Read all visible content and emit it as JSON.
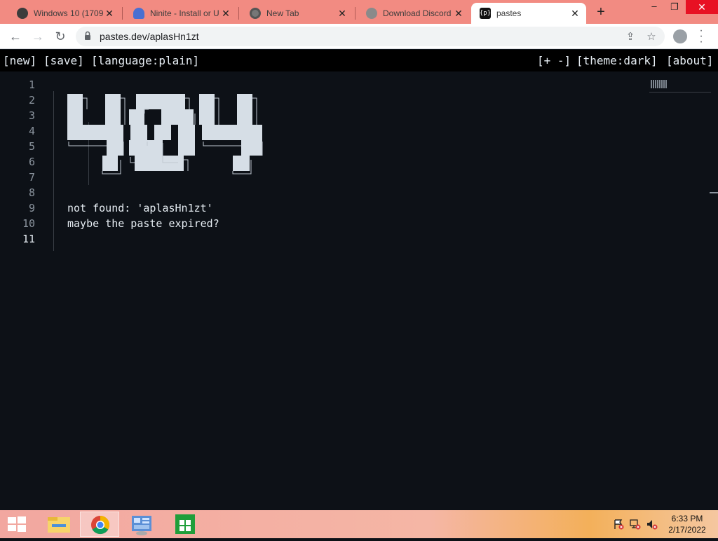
{
  "browser": {
    "tabs": [
      {
        "title": "Windows 10 (1709",
        "favicon": "dark-circle-icon"
      },
      {
        "title": "Ninite - Install or U",
        "favicon": "ninite-icon"
      },
      {
        "title": "New Tab",
        "favicon": "chrome-icon"
      },
      {
        "title": "Download Discord",
        "favicon": "globe-icon"
      },
      {
        "title": "pastes",
        "favicon": "pastes-icon",
        "active": true
      }
    ],
    "favicon_text": "{p}",
    "url": "pastes.dev/aplasHn1zt",
    "tabstrip_color": "#f28b82"
  },
  "appbar": {
    "new": "[new]",
    "save": "[save]",
    "language": "[language:plain]",
    "zoom": "[+ -]",
    "theme": "[theme:dark]",
    "about": "[about]"
  },
  "editor": {
    "line_numbers": [
      "1",
      "2",
      "3",
      "4",
      "5",
      "6",
      "7",
      "8",
      "9",
      "10",
      "11"
    ],
    "current_line": "11",
    "lines": {
      "l9": "not found: 'aplasHn1zt'",
      "l10": "maybe the paste expired?"
    },
    "ascii_art": "404"
  },
  "taskbar": {
    "time": "6:33 PM",
    "date": "2/17/2022"
  }
}
